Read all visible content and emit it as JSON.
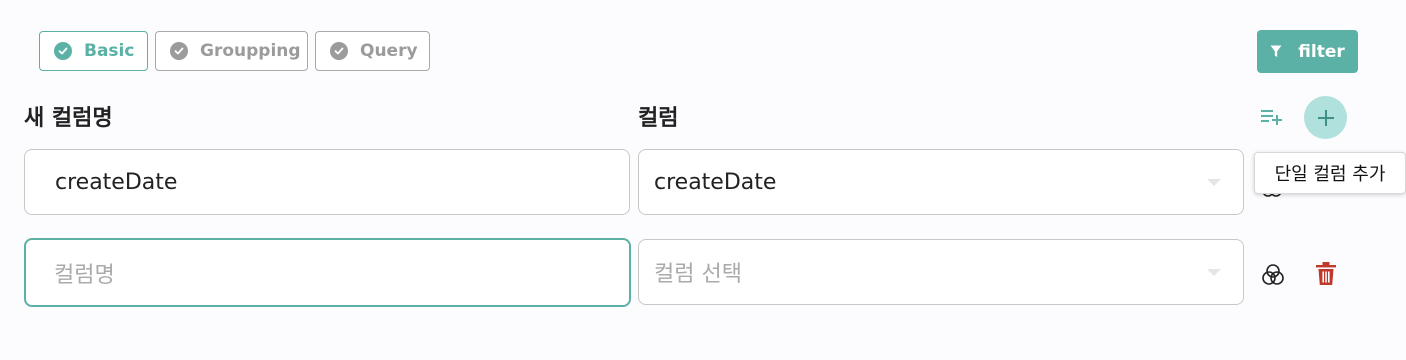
{
  "tabs": [
    {
      "label": "Basic",
      "active": true
    },
    {
      "label": "Groupping",
      "active": false
    },
    {
      "label": "Query",
      "active": false
    }
  ],
  "filter_button": {
    "label": "filter"
  },
  "columns": {
    "new_name_header": "새 컬럼명",
    "column_header": "컬럼"
  },
  "rows": [
    {
      "name_value": "createDate",
      "column_value": "createDate"
    },
    {
      "name_placeholder": "컬럼명",
      "column_placeholder": "컬럼 선택"
    }
  ],
  "tooltip": {
    "text": "단일 컬럼 추가"
  },
  "colors": {
    "accent": "#5bb1a6",
    "accent_light": "#b1e1dc",
    "delete": "#c0392b",
    "muted": "#9b9b9b"
  },
  "icons": [
    "check-circle-icon",
    "filter-icon",
    "add-list-icon",
    "plus-icon",
    "overlap-circles-icon",
    "trash-icon",
    "dropdown-caret-icon"
  ]
}
